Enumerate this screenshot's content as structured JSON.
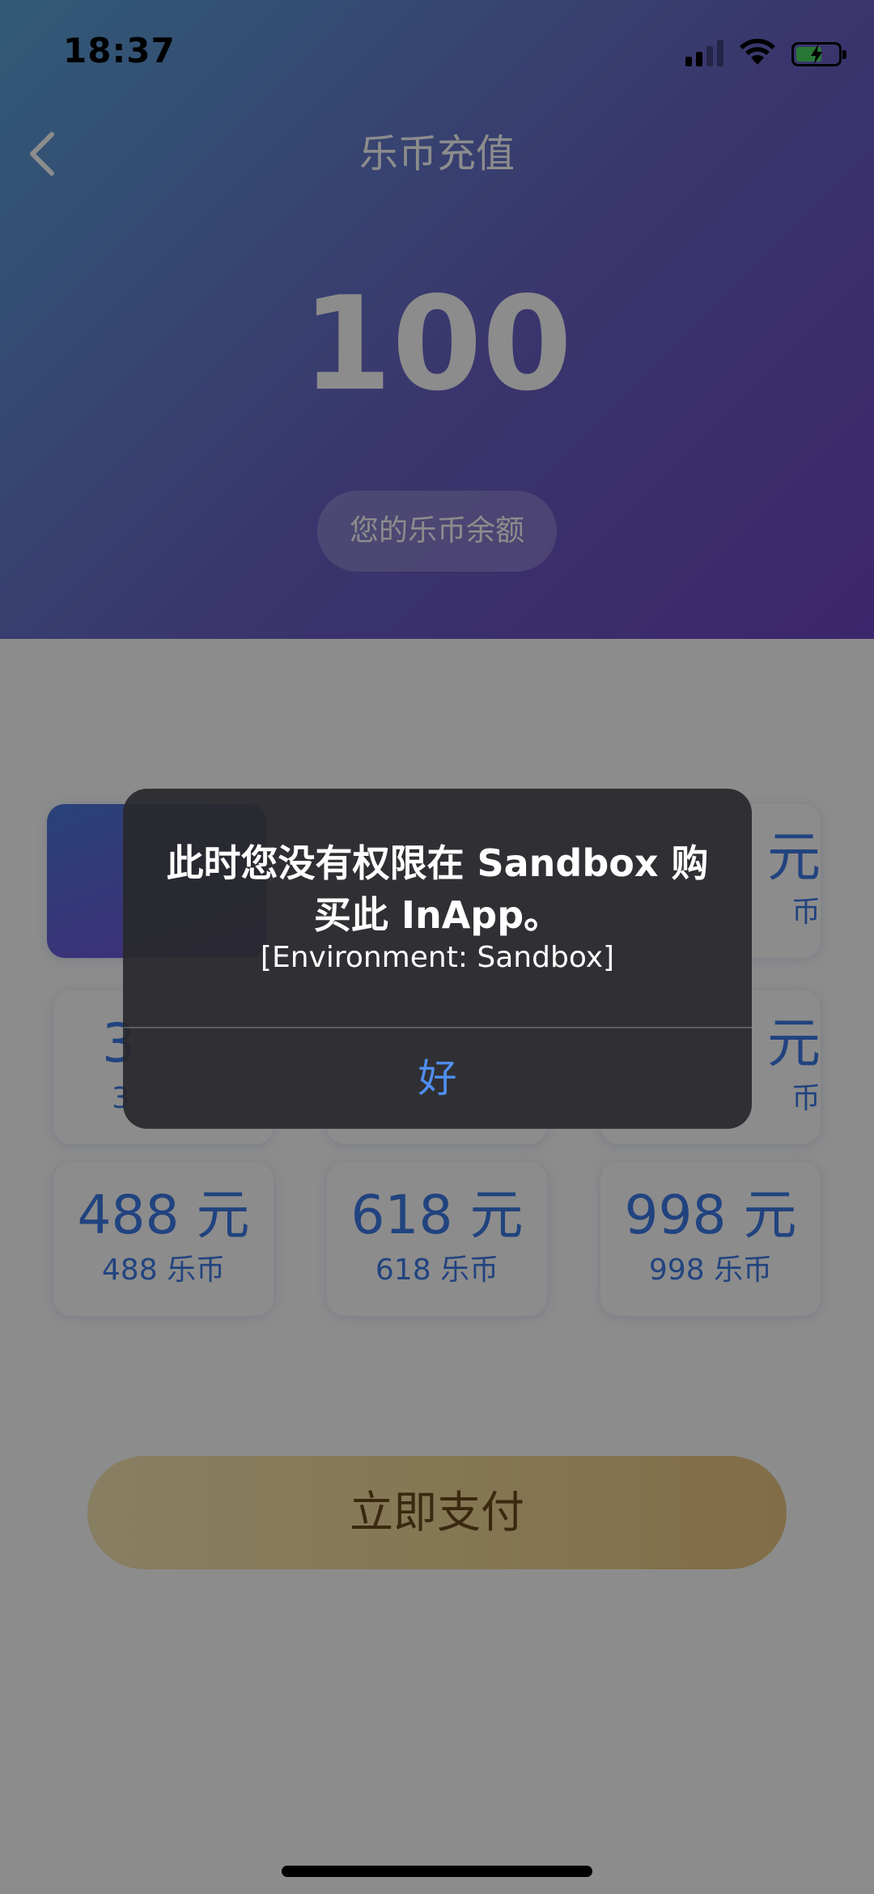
{
  "status_bar": {
    "time": "18:37",
    "icons": [
      "signal-icon",
      "wifi-icon",
      "battery-charging-icon"
    ]
  },
  "nav": {
    "back_icon": "chevron-left-icon",
    "title": "乐币充值"
  },
  "balance": {
    "value": "100",
    "label": "您的乐币余额"
  },
  "packages": [
    {
      "price": "",
      "coins": "",
      "selected": true
    },
    {
      "price": "",
      "coins": "",
      "selected": false
    },
    {
      "price": "元",
      "coins": "币",
      "selected": false
    },
    {
      "price": "3",
      "coins": "3",
      "selected": false
    },
    {
      "price": "",
      "coins": "",
      "selected": false
    },
    {
      "price": "元",
      "coins": "币",
      "selected": false
    },
    {
      "price": "488 元",
      "coins": "488 乐币",
      "selected": false
    },
    {
      "price": "618 元",
      "coins": "618 乐币",
      "selected": false
    },
    {
      "price": "998 元",
      "coins": "998 乐币",
      "selected": false
    }
  ],
  "pay_button": {
    "label": "立即支付"
  },
  "alert": {
    "title": "此时您没有权限在 Sandbox 购买此 InApp。",
    "message": "[Environment: Sandbox]",
    "ok_label": "好"
  },
  "colors": {
    "header_gradient_start": "#5aa6d9",
    "header_gradient_end": "#6e45c4",
    "package_text": "#3d7ae8",
    "pay_button_text": "#6b4a1d",
    "alert_button": "#4f8ff0"
  }
}
